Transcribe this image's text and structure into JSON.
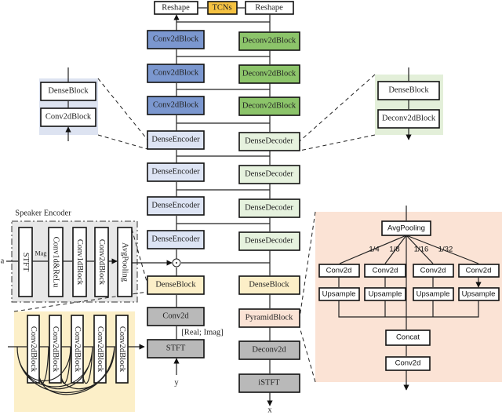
{
  "top": {
    "reshape_left": "Reshape",
    "tcns": "TCNs",
    "reshape_right": "Reshape"
  },
  "encoder": {
    "conv2dblocks": [
      "Conv2dBlock",
      "Conv2dBlock",
      "Conv2dBlock"
    ],
    "dense_encoders": [
      "DenseEncoder",
      "DenseEncoder",
      "DenseEncoder",
      "DenseEncoder"
    ],
    "dense_block": "DenseBlock",
    "conv2d": "Conv2d",
    "stft": "STFT",
    "real_imag": "[Real; Imag]",
    "input": "y"
  },
  "decoder": {
    "deconv2dblocks": [
      "Deconv2dBlock",
      "Deconv2dBlock",
      "Deconv2dBlock"
    ],
    "dense_decoders": [
      "DenseDecoder",
      "DenseDecoder",
      "DenseDecoder",
      "DenseDecoder"
    ],
    "dense_block": "DenseBlock",
    "pyramid_block": "PyramidBlock",
    "deconv2d": "Deconv2d",
    "istft": "iSTFT",
    "output": "x"
  },
  "encoder_inset": {
    "dense_block": "DenseBlock",
    "conv2dblock": "Conv2dBlock"
  },
  "decoder_inset": {
    "dense_block": "DenseBlock",
    "deconv2dblock": "Deconv2dBlock"
  },
  "speaker_encoder": {
    "title": "Speaker Encoder",
    "input": "a",
    "mag": "Mag",
    "blocks": [
      "STFT",
      "Conv1d&ReLu",
      "Conv1dBlock",
      "Conv2dBlock",
      "AvgPooling"
    ]
  },
  "dense_block_detail": {
    "blocks": [
      "Conv2dBlock",
      "Conv2dBlock",
      "Conv2dBlock",
      "Conv2dBlock",
      "Conv2dBlock"
    ]
  },
  "pyramid_detail": {
    "avgpooling": "AvgPooling",
    "scales": [
      "1/4",
      "1/8",
      "1/16",
      "1/32"
    ],
    "conv2d": [
      "Conv2d",
      "Conv2d",
      "Conv2d",
      "Conv2d"
    ],
    "upsample": [
      "Upsample",
      "Upsample",
      "Upsample",
      "Upsample"
    ],
    "concat": "Concat",
    "conv2d_out": "Conv2d"
  },
  "colors": {
    "conv2dblock": "#7b97cf",
    "deconv2dblock": "#8cc46a",
    "dense_encoder": "#dde4f4",
    "dense_decoder": "#e6f2de",
    "dense_block": "#fcefc8",
    "pyramid": "#fbe3d5",
    "gray_block": "#b9b9b9",
    "tcns": "#f5c242"
  }
}
